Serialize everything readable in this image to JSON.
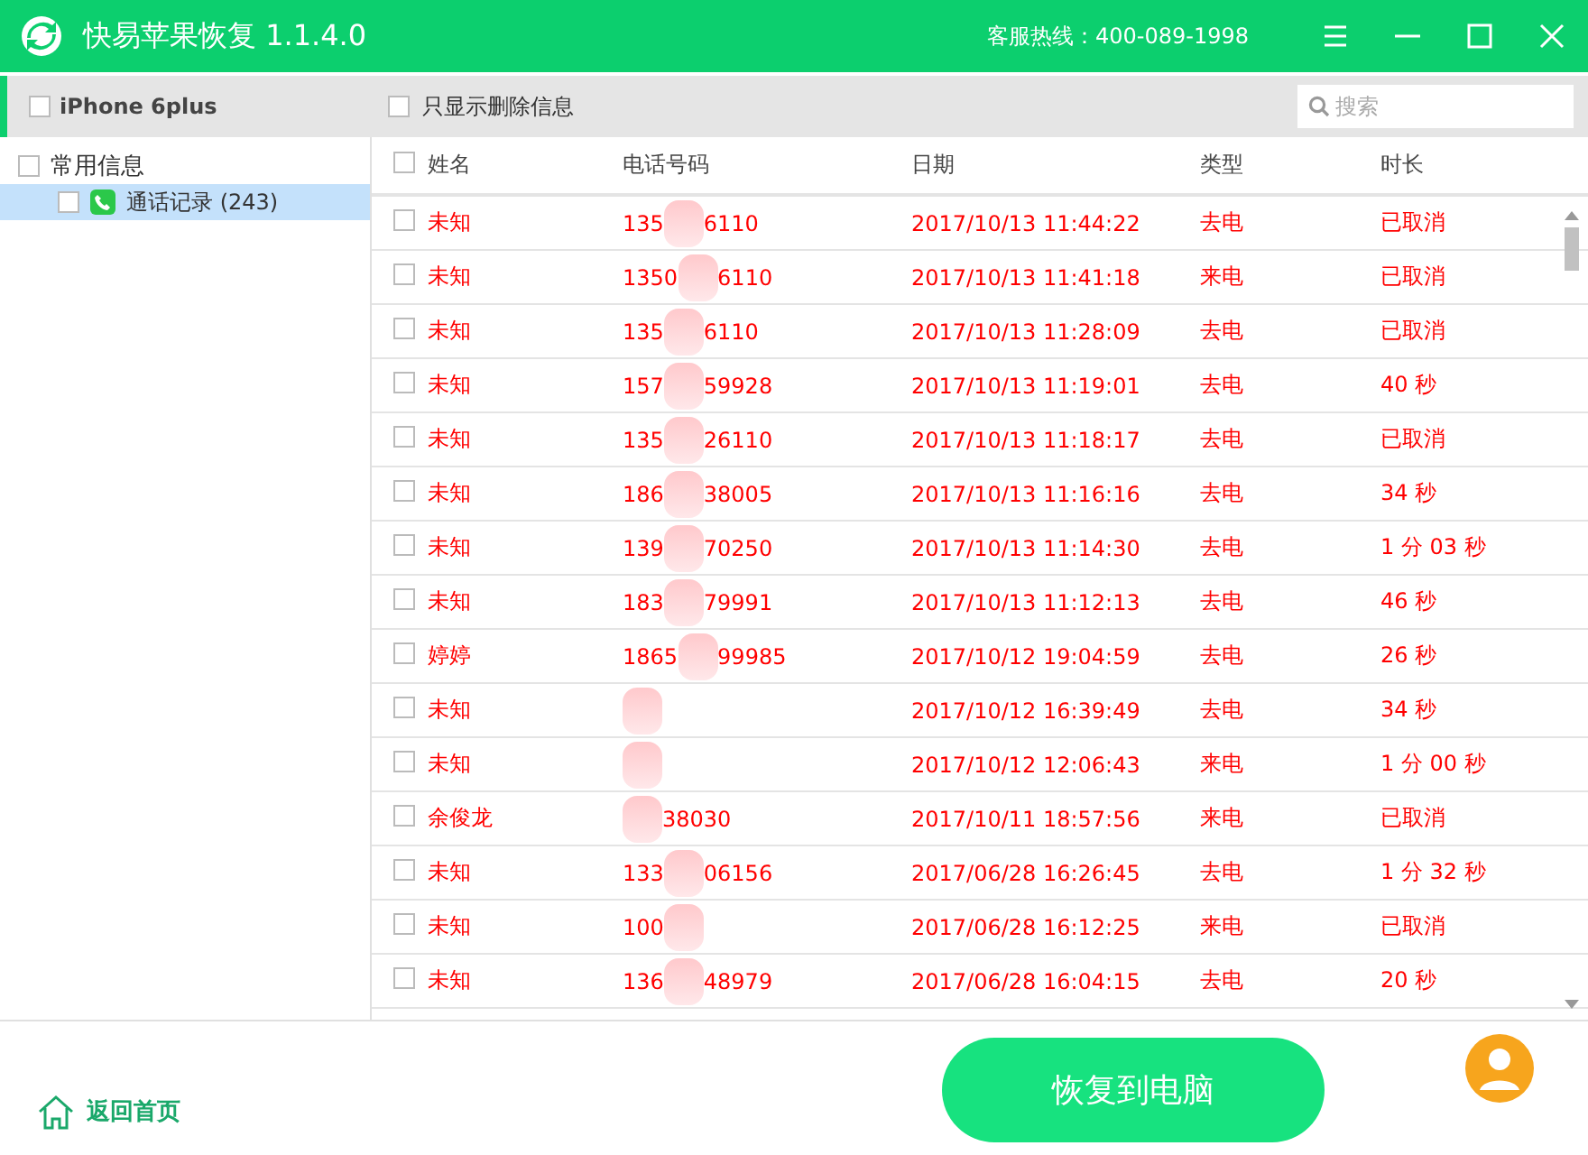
{
  "window": {
    "title": "快易苹果恢复 1.1.4.0",
    "hotline": "客服热线：400-089-1998"
  },
  "toolbar": {
    "device": {
      "label": "iPhone 6plus",
      "checked": false
    },
    "filter": {
      "label": "只显示删除信息",
      "checked": false
    },
    "search": {
      "placeholder": "搜索"
    }
  },
  "sidebar": {
    "items": [
      {
        "label": "常用信息",
        "checked": false,
        "selected": false,
        "children": [
          {
            "label": "通话记录 (243)",
            "checked": false,
            "selected": true
          }
        ]
      }
    ]
  },
  "table": {
    "columns": [
      "姓名",
      "电话号码",
      "日期",
      "类型",
      "时长"
    ],
    "all_checked": false,
    "rows": [
      {
        "checked": false,
        "name": "未知",
        "phone": {
          "start": "135",
          "end": "6110"
        },
        "date": "2017/10/13 11:44:22",
        "type": "去电",
        "duration": "已取消"
      },
      {
        "checked": false,
        "name": "未知",
        "phone": {
          "start": "1350",
          "end": "6110"
        },
        "date": "2017/10/13 11:41:18",
        "type": "来电",
        "duration": "已取消"
      },
      {
        "checked": false,
        "name": "未知",
        "phone": {
          "start": "135",
          "end": "6110"
        },
        "date": "2017/10/13 11:28:09",
        "type": "去电",
        "duration": "已取消"
      },
      {
        "checked": false,
        "name": "未知",
        "phone": {
          "start": "157",
          "end": "59928"
        },
        "date": "2017/10/13 11:19:01",
        "type": "去电",
        "duration": "40 秒"
      },
      {
        "checked": false,
        "name": "未知",
        "phone": {
          "start": "135",
          "end": "26110"
        },
        "date": "2017/10/13 11:18:17",
        "type": "去电",
        "duration": "已取消"
      },
      {
        "checked": false,
        "name": "未知",
        "phone": {
          "start": "186",
          "end": "38005"
        },
        "date": "2017/10/13 11:16:16",
        "type": "去电",
        "duration": "34 秒"
      },
      {
        "checked": false,
        "name": "未知",
        "phone": {
          "start": "139",
          "end": "70250"
        },
        "date": "2017/10/13 11:14:30",
        "type": "去电",
        "duration": "1 分 03 秒"
      },
      {
        "checked": false,
        "name": "未知",
        "phone": {
          "start": "183",
          "end": "79991"
        },
        "date": "2017/10/13 11:12:13",
        "type": "去电",
        "duration": "46 秒"
      },
      {
        "checked": false,
        "name": "婷婷",
        "phone": {
          "start": "1865",
          "end": "99985"
        },
        "date": "2017/10/12 19:04:59",
        "type": "去电",
        "duration": "26 秒"
      },
      {
        "checked": false,
        "name": "未知",
        "phone": {},
        "date": "2017/10/12 16:39:49",
        "type": "去电",
        "duration": "34 秒"
      },
      {
        "checked": false,
        "name": "未知",
        "phone": {},
        "date": "2017/10/12 12:06:43",
        "type": "来电",
        "duration": "1 分 00 秒"
      },
      {
        "checked": false,
        "name": "余俊龙",
        "phone": {
          "end": "38030"
        },
        "date": "2017/10/11 18:57:56",
        "type": "来电",
        "duration": "已取消"
      },
      {
        "checked": false,
        "name": "未知",
        "phone": {
          "start": "133",
          "end": "06156"
        },
        "date": "2017/06/28 16:26:45",
        "type": "去电",
        "duration": "1 分 32 秒"
      },
      {
        "checked": false,
        "name": "未知",
        "phone": {
          "start": "100"
        },
        "date": "2017/06/28 16:12:25",
        "type": "来电",
        "duration": "已取消"
      },
      {
        "checked": false,
        "name": "未知",
        "phone": {
          "start": "136",
          "end": "48979"
        },
        "date": "2017/06/28 16:04:15",
        "type": "去电",
        "duration": "20 秒"
      }
    ]
  },
  "footer": {
    "home": "返回首页",
    "recover": "恢复到电脑"
  }
}
